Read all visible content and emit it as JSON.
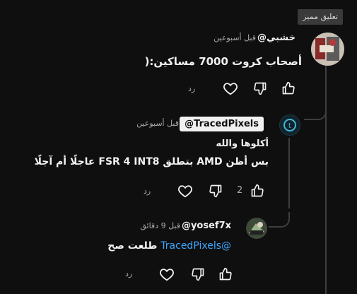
{
  "badge": "تعليق مميز",
  "comments": [
    {
      "author": "@خشبي",
      "time": "قبل أسبوعين",
      "text": "أصحاب كروت 7000 مساكين:(",
      "reply_label": "رد"
    },
    {
      "author": "@TracedPixels",
      "time": "قبل أسبوعين",
      "line1": "أكلوها والله",
      "line2": "بس أظن AMD بتطلق FSR 4 INT8 عاجلًا أم آجلًا",
      "likes": "2",
      "reply_label": "رد"
    },
    {
      "author": "@yosef7x",
      "time": "قبل 9 دقائق",
      "mention": "@TracedPixels",
      "text": "طلعت صح",
      "reply_label": "رد"
    }
  ],
  "icons": {
    "like": "thumbs-up-icon",
    "dislike": "thumbs-down-icon",
    "heart": "heart-icon"
  },
  "colors": {
    "background": "#0f0f0f",
    "mention": "#3ea6ff",
    "badge_bg": "#3a3a3a"
  }
}
